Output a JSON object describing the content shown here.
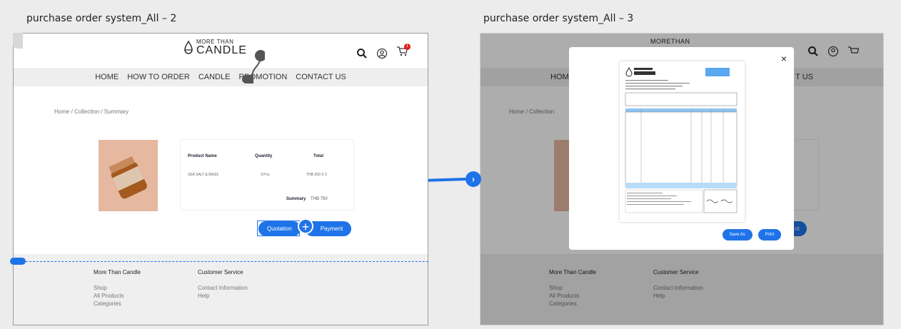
{
  "frames": {
    "left_title": "purchase order system_All – 2",
    "right_title": "purchase order system_All – 3"
  },
  "logo": {
    "line1": "MORE THAN",
    "line2": "CANDLE",
    "partial": "MORETHAN"
  },
  "nav": [
    "HOME",
    "HOW TO ORDER",
    "CANDLE",
    "PROMOTION",
    "CONTACT US"
  ],
  "nav_right": {
    "first": "HOME",
    "last": "T US"
  },
  "cart": {
    "count": "1"
  },
  "breadcrumb": "Home / Collection / Summary",
  "breadcrumb_right": "Home / Collection",
  "summary": {
    "headers": [
      "Product Name",
      "Quantity",
      "Total"
    ],
    "row": [
      "SEA SALT & BASIL",
      "3 Pcs",
      "THB 250 X 3"
    ],
    "summary_label": "Summary",
    "summary_value": "THB 750"
  },
  "buttons": {
    "quotation": "Quotation",
    "payment": "Payment",
    "right_partial": "nt"
  },
  "footer": {
    "col1_title": "More Than Candle",
    "col1_items": [
      "Shop",
      "All Products",
      "Categories"
    ],
    "col2_title": "Customer Service",
    "col2_items": [
      "Contact Information",
      "Help"
    ]
  },
  "modal": {
    "save_as": "Save As",
    "print": "Print",
    "close": "×"
  },
  "accent": "#1e73e8"
}
